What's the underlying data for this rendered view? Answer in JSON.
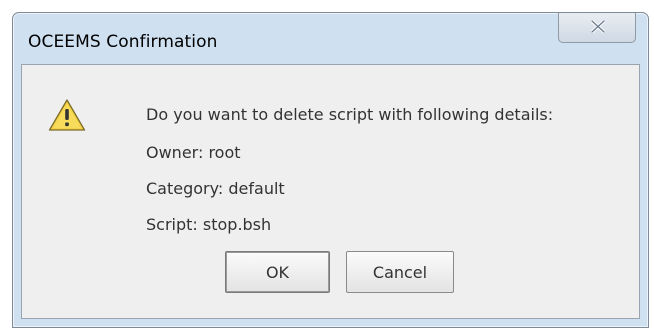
{
  "window": {
    "title": "OCEEMS Confirmation"
  },
  "titlebar": {
    "close_icon": "close-icon"
  },
  "dialog": {
    "icon": "warning-icon",
    "message_lines": [
      "Do you want to delete script with following details:",
      "Owner: root",
      "Category: default",
      "Script: stop.bsh"
    ],
    "buttons": {
      "ok_label": "OK",
      "cancel_label": "Cancel"
    }
  },
  "colors": {
    "frame": "#cfe0f1",
    "content_bg": "#efefef",
    "warning_fill": "#f5d245",
    "text": "#333333"
  }
}
